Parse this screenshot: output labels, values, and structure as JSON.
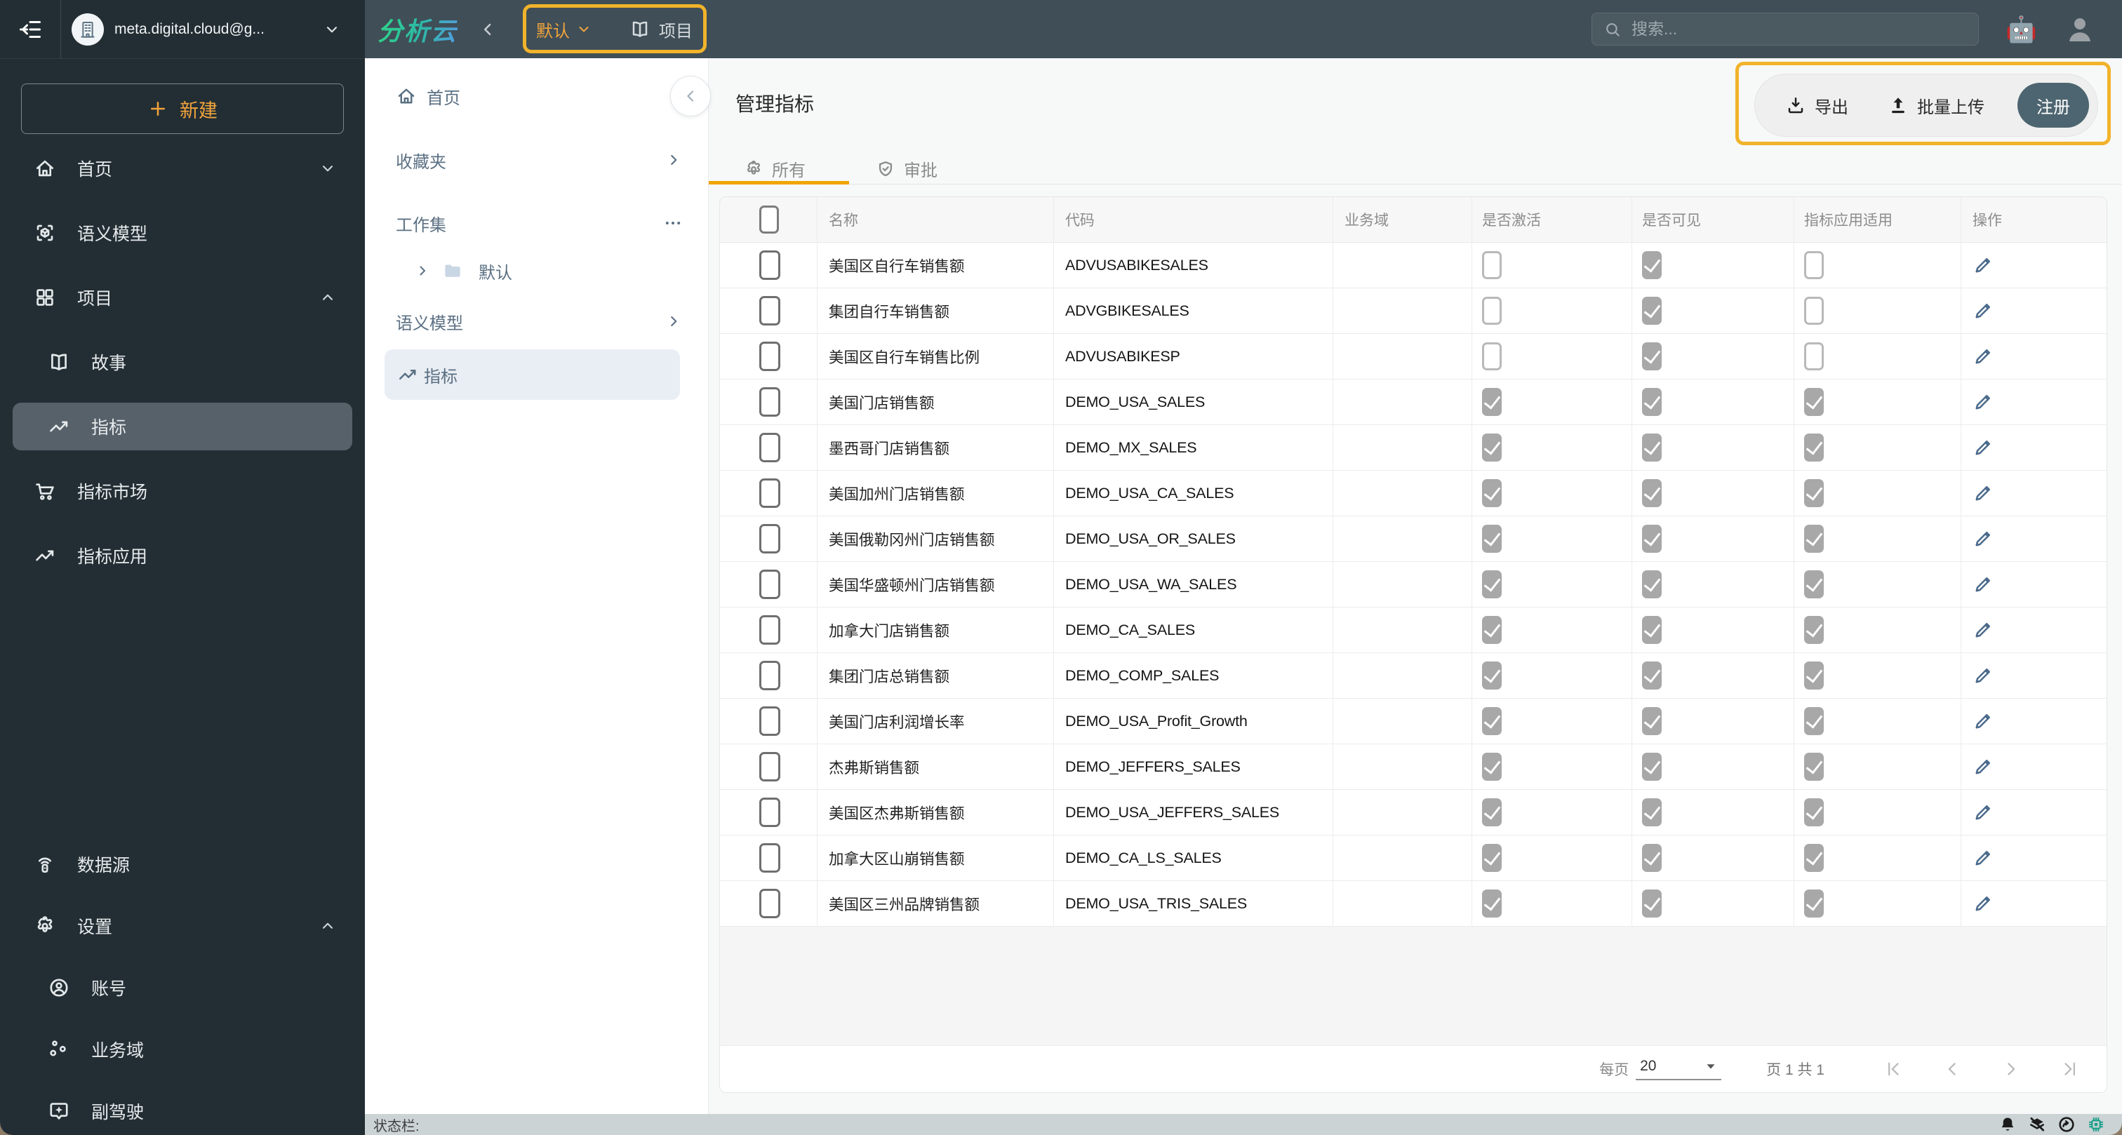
{
  "topbar": {
    "account": "meta.digital.cloud@g...",
    "logo": "分析云",
    "workspace": "默认",
    "project": "项目",
    "search_placeholder": "搜索...",
    "robot": "🤖"
  },
  "sidebar": {
    "new_label": "新建",
    "items": [
      {
        "label": "首页"
      },
      {
        "label": "语义模型"
      },
      {
        "label": "项目"
      },
      {
        "label": "故事"
      },
      {
        "label": "指标"
      },
      {
        "label": "指标市场"
      },
      {
        "label": "指标应用"
      },
      {
        "label": "数据源"
      },
      {
        "label": "设置"
      },
      {
        "label": "账号"
      },
      {
        "label": "业务域"
      },
      {
        "label": "副驾驶"
      }
    ]
  },
  "panel": {
    "items": [
      {
        "label": "首页"
      },
      {
        "label": "收藏夹"
      },
      {
        "label": "工作集"
      },
      {
        "label": "默认"
      },
      {
        "label": "语义模型"
      },
      {
        "label": "指标"
      }
    ]
  },
  "main": {
    "title": "管理指标",
    "actions": {
      "export": "导出",
      "bulk_upload": "批量上传",
      "register": "注册"
    },
    "tabs": [
      {
        "label": "所有"
      },
      {
        "label": "审批"
      }
    ],
    "table": {
      "columns": [
        "名称",
        "代码",
        "业务域",
        "是否激活",
        "是否可见",
        "指标应用适用",
        "操作"
      ],
      "rows": [
        {
          "name": "美国区自行车销售额",
          "code": "ADVUSABIKESALES",
          "domain": "",
          "active": false,
          "visible": true,
          "app": false
        },
        {
          "name": "集团自行车销售额",
          "code": "ADVGBIKESALES",
          "domain": "",
          "active": false,
          "visible": true,
          "app": false
        },
        {
          "name": "美国区自行车销售比例",
          "code": "ADVUSABIKESP",
          "domain": "",
          "active": false,
          "visible": true,
          "app": false
        },
        {
          "name": "美国门店销售额",
          "code": "DEMO_USA_SALES",
          "domain": "",
          "active": true,
          "visible": true,
          "app": true
        },
        {
          "name": "墨西哥门店销售额",
          "code": "DEMO_MX_SALES",
          "domain": "",
          "active": true,
          "visible": true,
          "app": true
        },
        {
          "name": "美国加州门店销售额",
          "code": "DEMO_USA_CA_SALES",
          "domain": "",
          "active": true,
          "visible": true,
          "app": true
        },
        {
          "name": "美国俄勒冈州门店销售额",
          "code": "DEMO_USA_OR_SALES",
          "domain": "",
          "active": true,
          "visible": true,
          "app": true
        },
        {
          "name": "美国华盛顿州门店销售额",
          "code": "DEMO_USA_WA_SALES",
          "domain": "",
          "active": true,
          "visible": true,
          "app": true
        },
        {
          "name": "加拿大门店销售额",
          "code": "DEMO_CA_SALES",
          "domain": "",
          "active": true,
          "visible": true,
          "app": true
        },
        {
          "name": "集团门店总销售额",
          "code": "DEMO_COMP_SALES",
          "domain": "",
          "active": true,
          "visible": true,
          "app": true
        },
        {
          "name": "美国门店利润增长率",
          "code": "DEMO_USA_Profit_Growth",
          "domain": "",
          "active": true,
          "visible": true,
          "app": true
        },
        {
          "name": "杰弗斯销售额",
          "code": "DEMO_JEFFERS_SALES",
          "domain": "",
          "active": true,
          "visible": true,
          "app": true
        },
        {
          "name": "美国区杰弗斯销售额",
          "code": "DEMO_USA_JEFFERS_SALES",
          "domain": "",
          "active": true,
          "visible": true,
          "app": true
        },
        {
          "name": "加拿大区山崩销售额",
          "code": "DEMO_CA_LS_SALES",
          "domain": "",
          "active": true,
          "visible": true,
          "app": true
        },
        {
          "name": "美国区三州品牌销售额",
          "code": "DEMO_USA_TRIS_SALES",
          "domain": "",
          "active": true,
          "visible": true,
          "app": true
        }
      ]
    },
    "pagination": {
      "per_page_label": "每页",
      "per_page": "20",
      "page_info": "页 1 共 1"
    }
  },
  "statusbar": {
    "label": "状态栏:"
  },
  "colors": {
    "accent": "#f0a43c",
    "annotation": "#f1b32b",
    "register_bg": "#4d6570",
    "logo_gradient": "#2fd08d → #4f9fd8",
    "edit_icon": "#4a6a8c",
    "chip_icon": "#17a089"
  }
}
